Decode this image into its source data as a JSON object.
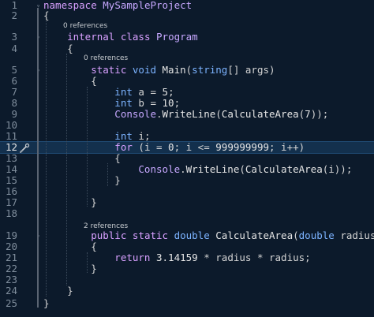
{
  "editor": {
    "lines": [
      {
        "n": "1",
        "tokens": [
          [
            "kw",
            "namespace"
          ],
          [
            "pun",
            " "
          ],
          [
            "ty",
            "MySampleProject"
          ]
        ]
      },
      {
        "n": "2",
        "tokens": [
          [
            "pun",
            "{"
          ]
        ]
      },
      {
        "n": "3",
        "tokens": [
          [
            "kw",
            "    internal"
          ],
          [
            "pun",
            " "
          ],
          [
            "kw",
            "class"
          ],
          [
            "pun",
            " "
          ],
          [
            "ty",
            "Program"
          ]
        ]
      },
      {
        "n": "4",
        "tokens": [
          [
            "pun",
            "    {"
          ]
        ]
      },
      {
        "n": "5",
        "tokens": [
          [
            "kw",
            "        static"
          ],
          [
            "pun",
            " "
          ],
          [
            "kwb",
            "void"
          ],
          [
            "pun",
            " "
          ],
          [
            "fn",
            "Main"
          ],
          [
            "pun",
            "("
          ],
          [
            "kwb",
            "string"
          ],
          [
            "pun",
            "[] "
          ],
          [
            "pun",
            "args"
          ],
          [
            "pun",
            ")"
          ]
        ]
      },
      {
        "n": "6",
        "tokens": [
          [
            "pun",
            "        {"
          ]
        ]
      },
      {
        "n": "7",
        "tokens": [
          [
            "kwb",
            "            int"
          ],
          [
            "pun",
            " "
          ],
          [
            "pun",
            "a"
          ],
          [
            "pun",
            " = "
          ],
          [
            "num",
            "5"
          ],
          [
            "pun",
            ";"
          ]
        ]
      },
      {
        "n": "8",
        "tokens": [
          [
            "kwb",
            "            int"
          ],
          [
            "pun",
            " "
          ],
          [
            "pun",
            "b"
          ],
          [
            "pun",
            " = "
          ],
          [
            "num",
            "10"
          ],
          [
            "pun",
            ";"
          ]
        ]
      },
      {
        "n": "9",
        "tokens": [
          [
            "ty",
            "            Console"
          ],
          [
            "pun",
            "."
          ],
          [
            "fn",
            "WriteLine"
          ],
          [
            "pun",
            "("
          ],
          [
            "fn",
            "CalculateArea"
          ],
          [
            "pun",
            "("
          ],
          [
            "num",
            "7"
          ],
          [
            "pun",
            "));"
          ]
        ]
      },
      {
        "n": "10",
        "tokens": []
      },
      {
        "n": "11",
        "tokens": [
          [
            "kwb",
            "            int"
          ],
          [
            "pun",
            " i;"
          ]
        ]
      },
      {
        "n": "12",
        "tokens": [
          [
            "kw",
            "            for"
          ],
          [
            "pun",
            " (i = "
          ],
          [
            "num",
            "0"
          ],
          [
            "pun",
            "; i <= "
          ],
          [
            "num",
            "999999999"
          ],
          [
            "pun",
            "; i++)"
          ]
        ]
      },
      {
        "n": "13",
        "tokens": [
          [
            "pun",
            "            {"
          ]
        ]
      },
      {
        "n": "14",
        "tokens": [
          [
            "ty",
            "                Console"
          ],
          [
            "pun",
            "."
          ],
          [
            "fn",
            "WriteLine"
          ],
          [
            "pun",
            "("
          ],
          [
            "fn",
            "CalculateArea"
          ],
          [
            "pun",
            "(i));"
          ]
        ]
      },
      {
        "n": "15",
        "tokens": [
          [
            "pun",
            "            }"
          ]
        ]
      },
      {
        "n": "16",
        "tokens": []
      },
      {
        "n": "17",
        "tokens": [
          [
            "pun",
            "        }"
          ]
        ]
      },
      {
        "n": "18",
        "tokens": []
      },
      {
        "n": "19",
        "tokens": [
          [
            "kw",
            "        public"
          ],
          [
            "pun",
            " "
          ],
          [
            "kw",
            "static"
          ],
          [
            "pun",
            " "
          ],
          [
            "kwb",
            "double"
          ],
          [
            "pun",
            " "
          ],
          [
            "fn",
            "CalculateArea"
          ],
          [
            "pun",
            "("
          ],
          [
            "kwb",
            "double"
          ],
          [
            "pun",
            " radius)"
          ]
        ]
      },
      {
        "n": "20",
        "tokens": [
          [
            "pun",
            "        {"
          ]
        ]
      },
      {
        "n": "21",
        "tokens": [
          [
            "kw",
            "            return"
          ],
          [
            "pun",
            " "
          ],
          [
            "num",
            "3.14159"
          ],
          [
            "pun",
            " * radius * radius;"
          ]
        ]
      },
      {
        "n": "22",
        "tokens": [
          [
            "pun",
            "        }"
          ]
        ]
      },
      {
        "n": "23",
        "tokens": []
      },
      {
        "n": "24",
        "tokens": [
          [
            "pun",
            "    }"
          ]
        ]
      },
      {
        "n": "25",
        "tokens": [
          [
            "pun",
            "}"
          ]
        ]
      }
    ],
    "references": {
      "class_program": "0 references",
      "method_main": "0 references",
      "method_calculate_area": "2 references"
    },
    "current_line": "12"
  }
}
